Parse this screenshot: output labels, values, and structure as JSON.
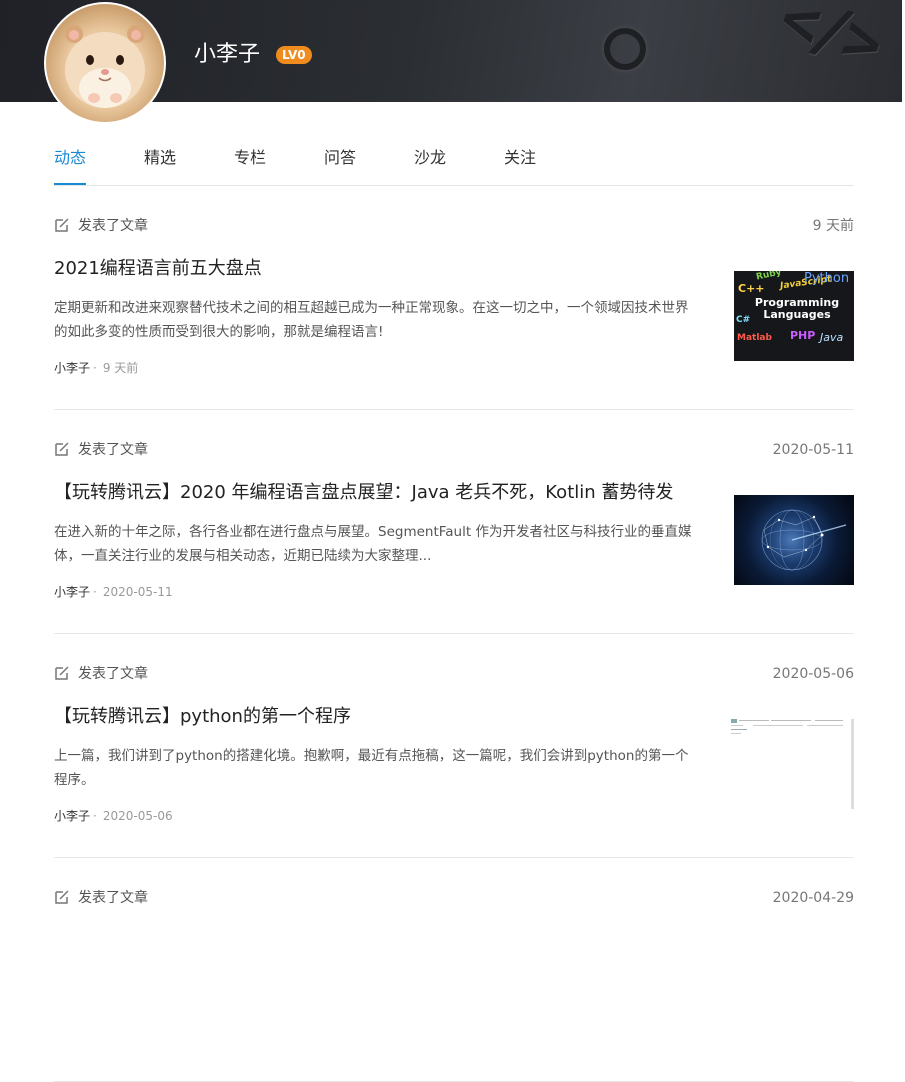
{
  "profile": {
    "username": "小李子",
    "level": "LV0"
  },
  "tabs": [
    {
      "label": "动态",
      "active": true
    },
    {
      "label": "精选",
      "active": false
    },
    {
      "label": "专栏",
      "active": false
    },
    {
      "label": "问答",
      "active": false
    },
    {
      "label": "沙龙",
      "active": false
    },
    {
      "label": "关注",
      "active": false
    }
  ],
  "feed": [
    {
      "action": "发表了文章",
      "date": "9 天前",
      "title": "2021编程语言前五大盘点",
      "excerpt": "定期更新和改进来观察替代技术之间的相互超越已成为一种正常现象。在这一切之中，一个领域因技术世界的如此多变的性质而受到很大的影响，那就是编程语言!",
      "author": "小李子",
      "time": "9 天前",
      "thumb": {
        "type": "programming-languages",
        "heading": "Programming Languages",
        "words": [
          "Ruby",
          "JavaScript",
          "Python",
          "C++",
          "C#",
          "Matlab",
          "PHP",
          "Java"
        ]
      }
    },
    {
      "action": "发表了文章",
      "date": "2020-05-11",
      "title": "【玩转腾讯云】2020 年编程语言盘点展望：Java 老兵不死，Kotlin 蓄势待发",
      "excerpt": "在进入新的十年之际，各行各业都在进行盘点与展望。SegmentFault 作为开发者社区与科技行业的垂直媒体，一直关注行业的发展与相关动态，近期已陆续为大家整理...",
      "author": "小李子",
      "time": "2020-05-11",
      "thumb": {
        "type": "globe"
      }
    },
    {
      "action": "发表了文章",
      "date": "2020-05-06",
      "title": "【玩转腾讯云】python的第一个程序",
      "excerpt": "上一篇，我们讲到了python的搭建化境。抱歉啊，最近有点拖稿，这一篇呢，我们会讲到python的第一个程序。",
      "author": "小李子",
      "time": "2020-05-06",
      "thumb": {
        "type": "document"
      }
    },
    {
      "action": "发表了文章",
      "date": "2020-04-29"
    }
  ],
  "colors": {
    "accent": "#1b8ad6",
    "badge": "#f08c1e",
    "banner": "#2b2e33"
  }
}
